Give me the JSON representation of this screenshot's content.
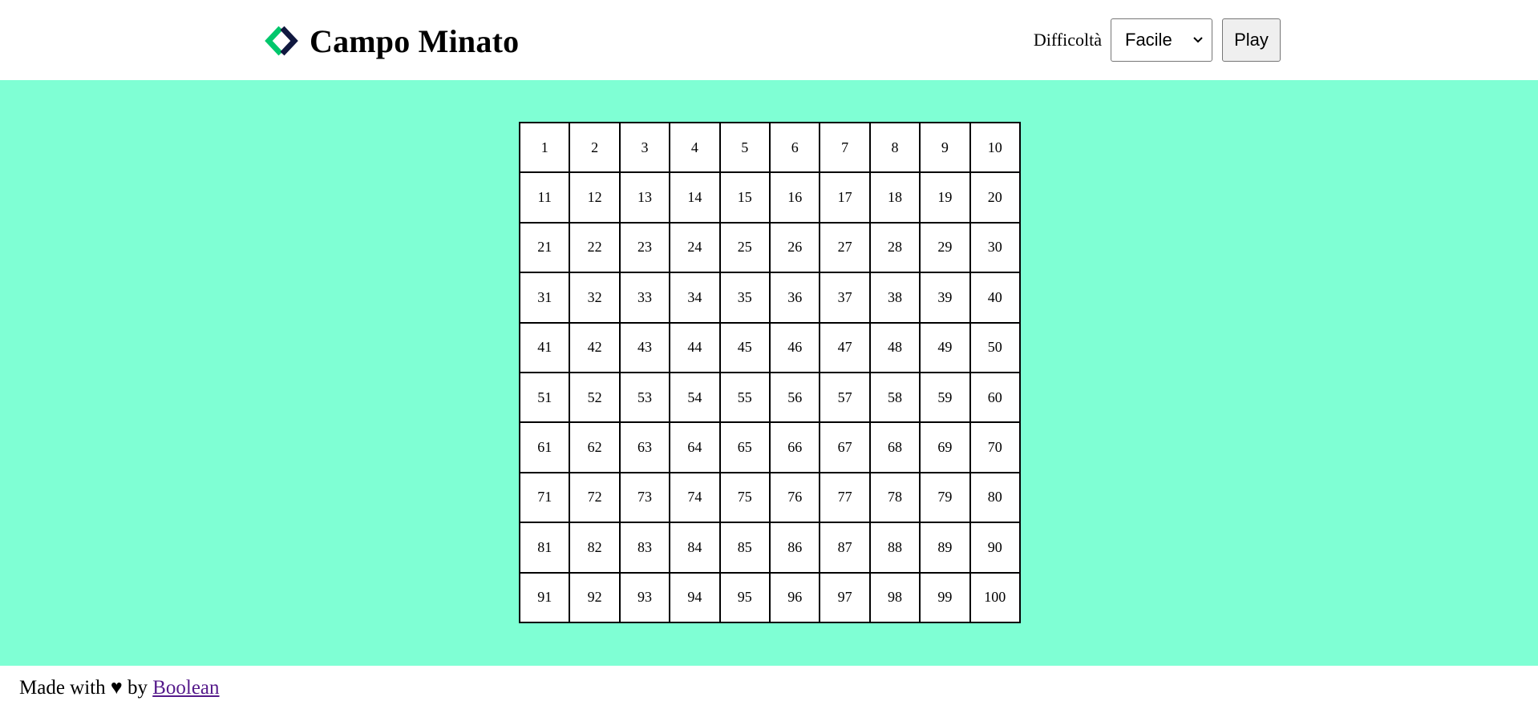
{
  "header": {
    "title": "Campo Minato",
    "logo": {
      "icon": "diamond-chevron-icon",
      "colors": {
        "left": "#00c76c",
        "right": "#10183f"
      }
    },
    "difficulty_label": "Difficoltà",
    "difficulty_select": {
      "selected": "Facile",
      "icon": "chevron-down-icon"
    },
    "play_label": "Play"
  },
  "board": {
    "background": "#7fffd4",
    "cells": [
      "1",
      "2",
      "3",
      "4",
      "5",
      "6",
      "7",
      "8",
      "9",
      "10",
      "11",
      "12",
      "13",
      "14",
      "15",
      "16",
      "17",
      "18",
      "19",
      "20",
      "21",
      "22",
      "23",
      "24",
      "25",
      "26",
      "27",
      "28",
      "29",
      "30",
      "31",
      "32",
      "33",
      "34",
      "35",
      "36",
      "37",
      "38",
      "39",
      "40",
      "41",
      "42",
      "43",
      "44",
      "45",
      "46",
      "47",
      "48",
      "49",
      "50",
      "51",
      "52",
      "53",
      "54",
      "55",
      "56",
      "57",
      "58",
      "59",
      "60",
      "61",
      "62",
      "63",
      "64",
      "65",
      "66",
      "67",
      "68",
      "69",
      "70",
      "71",
      "72",
      "73",
      "74",
      "75",
      "76",
      "77",
      "78",
      "79",
      "80",
      "81",
      "82",
      "83",
      "84",
      "85",
      "86",
      "87",
      "88",
      "89",
      "90",
      "91",
      "92",
      "93",
      "94",
      "95",
      "96",
      "97",
      "98",
      "99",
      "100"
    ]
  },
  "footer": {
    "prefix": "Made with",
    "heart": "♥",
    "by": "by",
    "link_text": "Boolean"
  }
}
